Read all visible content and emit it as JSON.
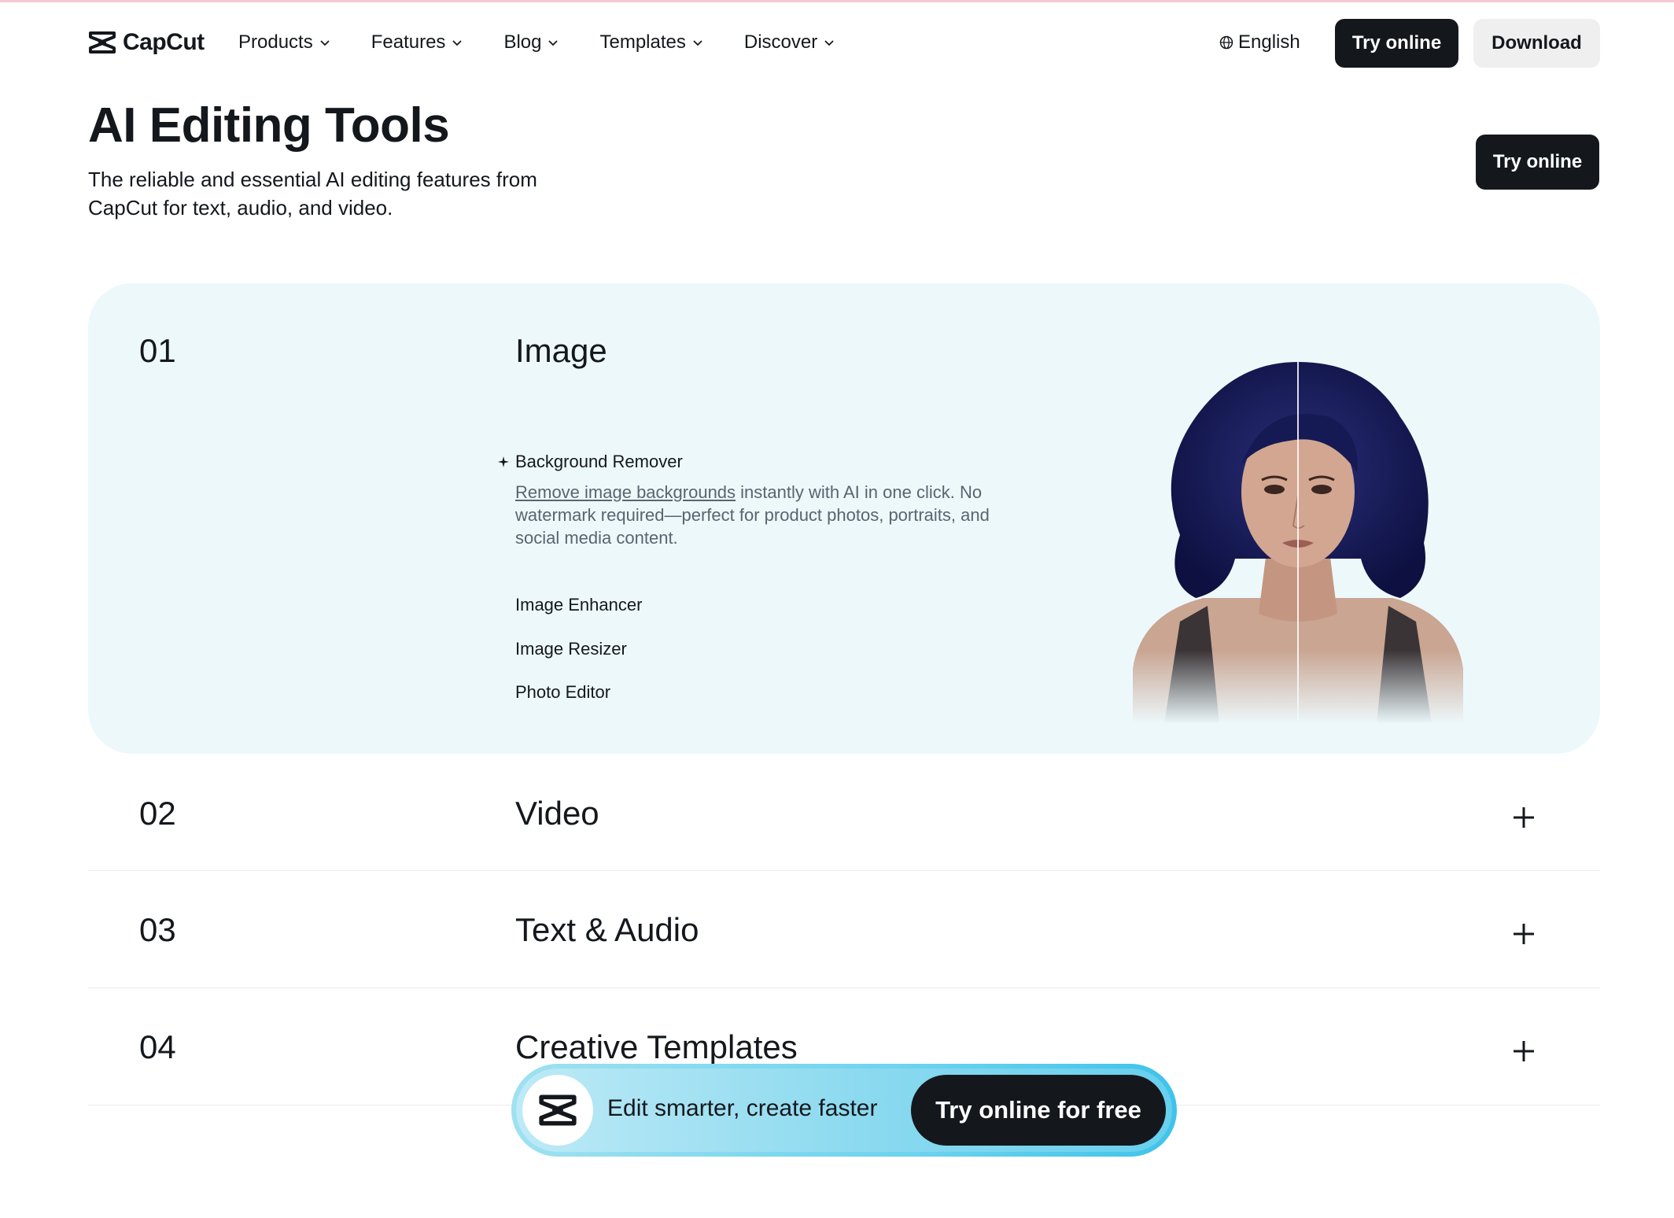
{
  "nav": {
    "brand": "CapCut",
    "menu": [
      {
        "label": "Products"
      },
      {
        "label": "Features"
      },
      {
        "label": "Blog"
      },
      {
        "label": "Templates"
      },
      {
        "label": "Discover"
      }
    ],
    "language": "English",
    "try_online": "Try online",
    "download": "Download"
  },
  "header": {
    "title": "AI Editing Tools",
    "subtitle": "The reliable and essential AI editing features from CapCut for text, audio, and video.",
    "try_online": "Try online"
  },
  "sections": [
    {
      "number": "01",
      "title": "Image",
      "expanded": true,
      "active_feature": {
        "label": "Background Remover",
        "link_text": "Remove image backgrounds",
        "description": " instantly with AI in one click. No watermark required—perfect for product photos, portraits, and social media content."
      },
      "features": [
        "Image Enhancer",
        "Image Resizer",
        "Photo Editor"
      ]
    },
    {
      "number": "02",
      "title": "Video",
      "expanded": false
    },
    {
      "number": "03",
      "title": "Text & Audio",
      "expanded": false
    },
    {
      "number": "04",
      "title": "Creative Templates",
      "expanded": false
    }
  ],
  "banner": {
    "text": "Edit smarter, create faster",
    "button": "Try online for free"
  },
  "colors": {
    "dark": "#14181d",
    "panel_bg": "#edf8fb",
    "banner_accent": "#6dd3ee"
  }
}
